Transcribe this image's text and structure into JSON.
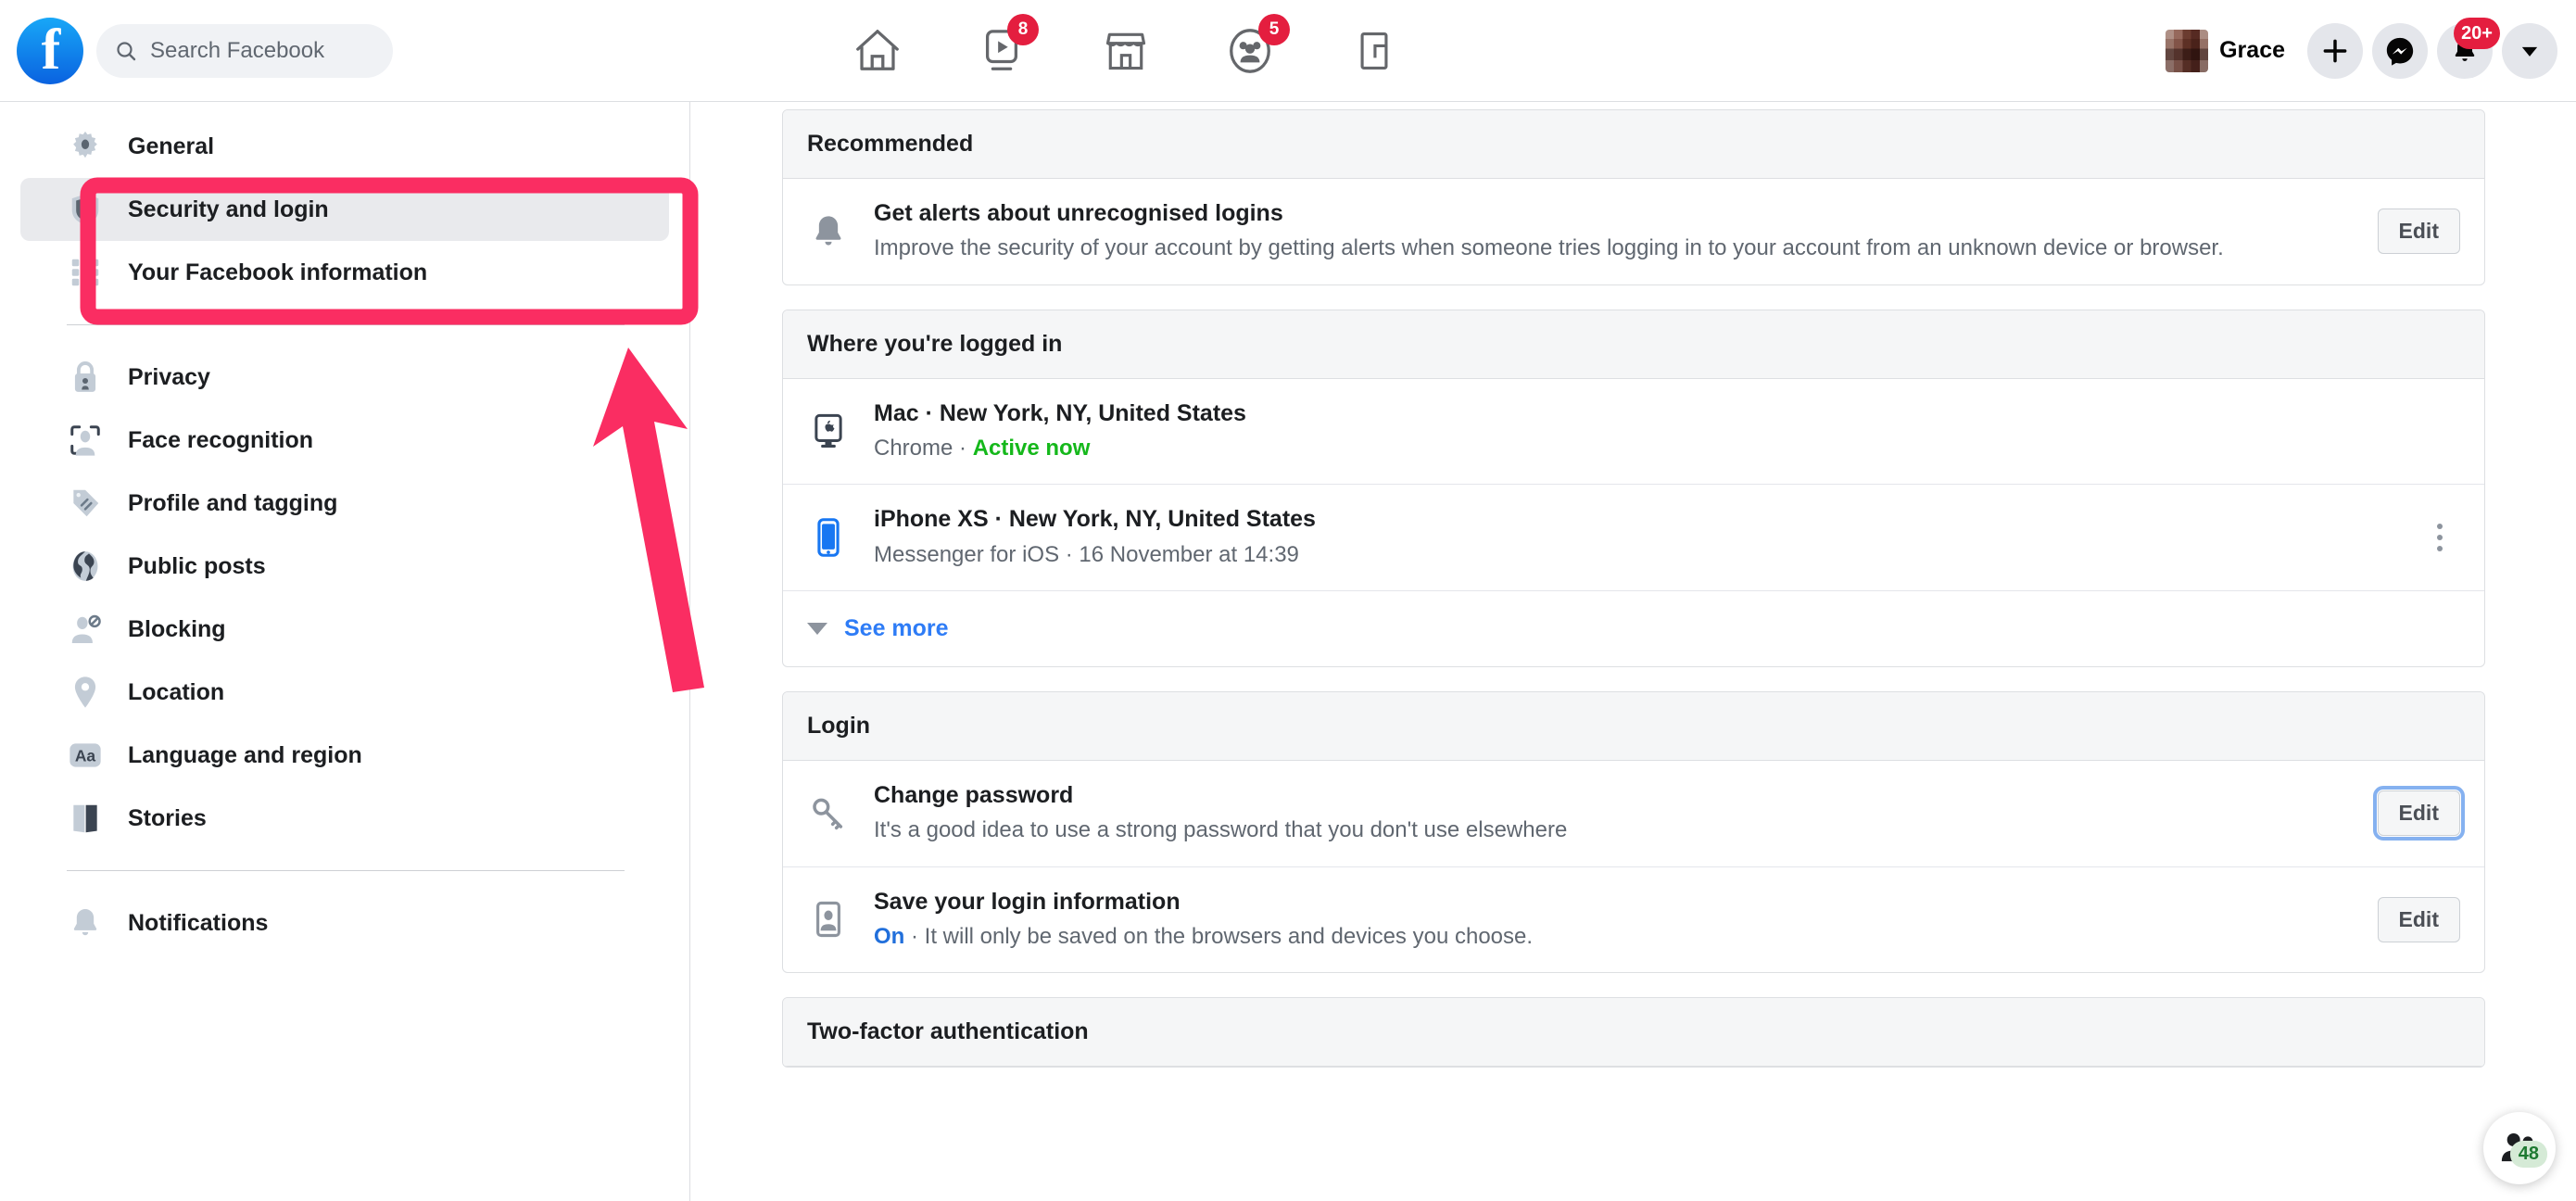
{
  "header": {
    "logo_icon": "facebook-logo-icon",
    "search": {
      "icon": "search-icon",
      "placeholder": "Search Facebook",
      "value": ""
    },
    "nav_tabs": [
      {
        "name": "home",
        "icon": "home-icon",
        "badge": ""
      },
      {
        "name": "watch",
        "icon": "video-play-icon",
        "badge": "8"
      },
      {
        "name": "marketplace",
        "icon": "storefront-icon",
        "badge": ""
      },
      {
        "name": "groups",
        "icon": "groups-people-icon",
        "badge": "5"
      },
      {
        "name": "gaming",
        "icon": "gaming-icon",
        "badge": ""
      }
    ],
    "profile": {
      "name": "Grace",
      "avatar_icon": "user-avatar"
    },
    "actions": [
      {
        "name": "create",
        "icon": "plus-icon",
        "badge": ""
      },
      {
        "name": "messenger",
        "icon": "messenger-icon",
        "badge": ""
      },
      {
        "name": "notifications",
        "icon": "bell-icon",
        "badge": "20+"
      },
      {
        "name": "account-menu",
        "icon": "chevron-down-icon",
        "badge": ""
      }
    ]
  },
  "sidebar": {
    "group_one": [
      {
        "label": "General",
        "icon": "gear-icon",
        "active": false
      },
      {
        "label": "Security and login",
        "icon": "shield-icon",
        "active": true
      },
      {
        "label": "Your Facebook information",
        "icon": "grid-dots-icon",
        "active": false
      }
    ],
    "group_two": [
      {
        "label": "Privacy",
        "icon": "lock-icon",
        "active": false
      },
      {
        "label": "Face recognition",
        "icon": "face-scan-icon",
        "active": false
      },
      {
        "label": "Profile and tagging",
        "icon": "tag-icon",
        "active": false
      },
      {
        "label": "Public posts",
        "icon": "globe-icon",
        "active": false
      },
      {
        "label": "Blocking",
        "icon": "user-block-icon",
        "active": false
      },
      {
        "label": "Location",
        "icon": "map-pin-icon",
        "active": false
      },
      {
        "label": "Language and region",
        "icon": "language-aa-icon",
        "active": false
      },
      {
        "label": "Stories",
        "icon": "book-icon",
        "active": false
      }
    ],
    "group_three": [
      {
        "label": "Notifications",
        "icon": "bell-icon",
        "active": false
      }
    ]
  },
  "main": {
    "cards": [
      {
        "id": "recommended",
        "title": "Recommended",
        "rows": [
          {
            "icon": "bell-icon",
            "title": "Get alerts about unrecognised logins",
            "sub": "Improve the security of your account by getting alerts when someone tries logging in to your account from an unknown device or browser.",
            "action": "Edit",
            "focused": false
          }
        ]
      },
      {
        "id": "where-logged-in",
        "title": "Where you're logged in",
        "rows": [
          {
            "icon": "mac-computer-icon",
            "title": "Mac · New York, NY, United States",
            "sub_prefix": "Chrome · ",
            "sub_status": "Active now",
            "action": ""
          },
          {
            "icon": "iphone-icon",
            "title": "iPhone XS · New York, NY, United States",
            "sub": "Messenger for iOS · 16 November at 14:39",
            "action": "kebab-menu"
          }
        ],
        "footer": {
          "label": "See more",
          "icon": "caret-down-icon"
        }
      },
      {
        "id": "login",
        "title": "Login",
        "rows": [
          {
            "icon": "key-icon",
            "title": "Change password",
            "sub": "It's a good idea to use a strong password that you don't use elsewhere",
            "action": "Edit",
            "focused": true
          },
          {
            "icon": "id-card-icon",
            "title": "Save your login information",
            "sub_state": "On",
            "sub_rest": " · It will only be saved on the browsers and devices you choose.",
            "action": "Edit",
            "focused": false
          }
        ]
      },
      {
        "id": "two-factor",
        "title": "Two-factor authentication",
        "rows": []
      }
    ]
  },
  "contacts_fab": {
    "icon": "contacts-people-icon",
    "count": "48"
  },
  "annotation": {
    "highlight_color": "#fa2d62",
    "highlight_target": "Security and login",
    "arrow_icon": "arrow-up-icon"
  },
  "colors": {
    "brand_blue": "#1877f2",
    "link_blue": "#2e7cf6",
    "active_green": "#15b81b",
    "badge_red": "#e41e3f",
    "annotation_pink": "#fa2d62",
    "panel_grey": "#f5f6f7"
  }
}
